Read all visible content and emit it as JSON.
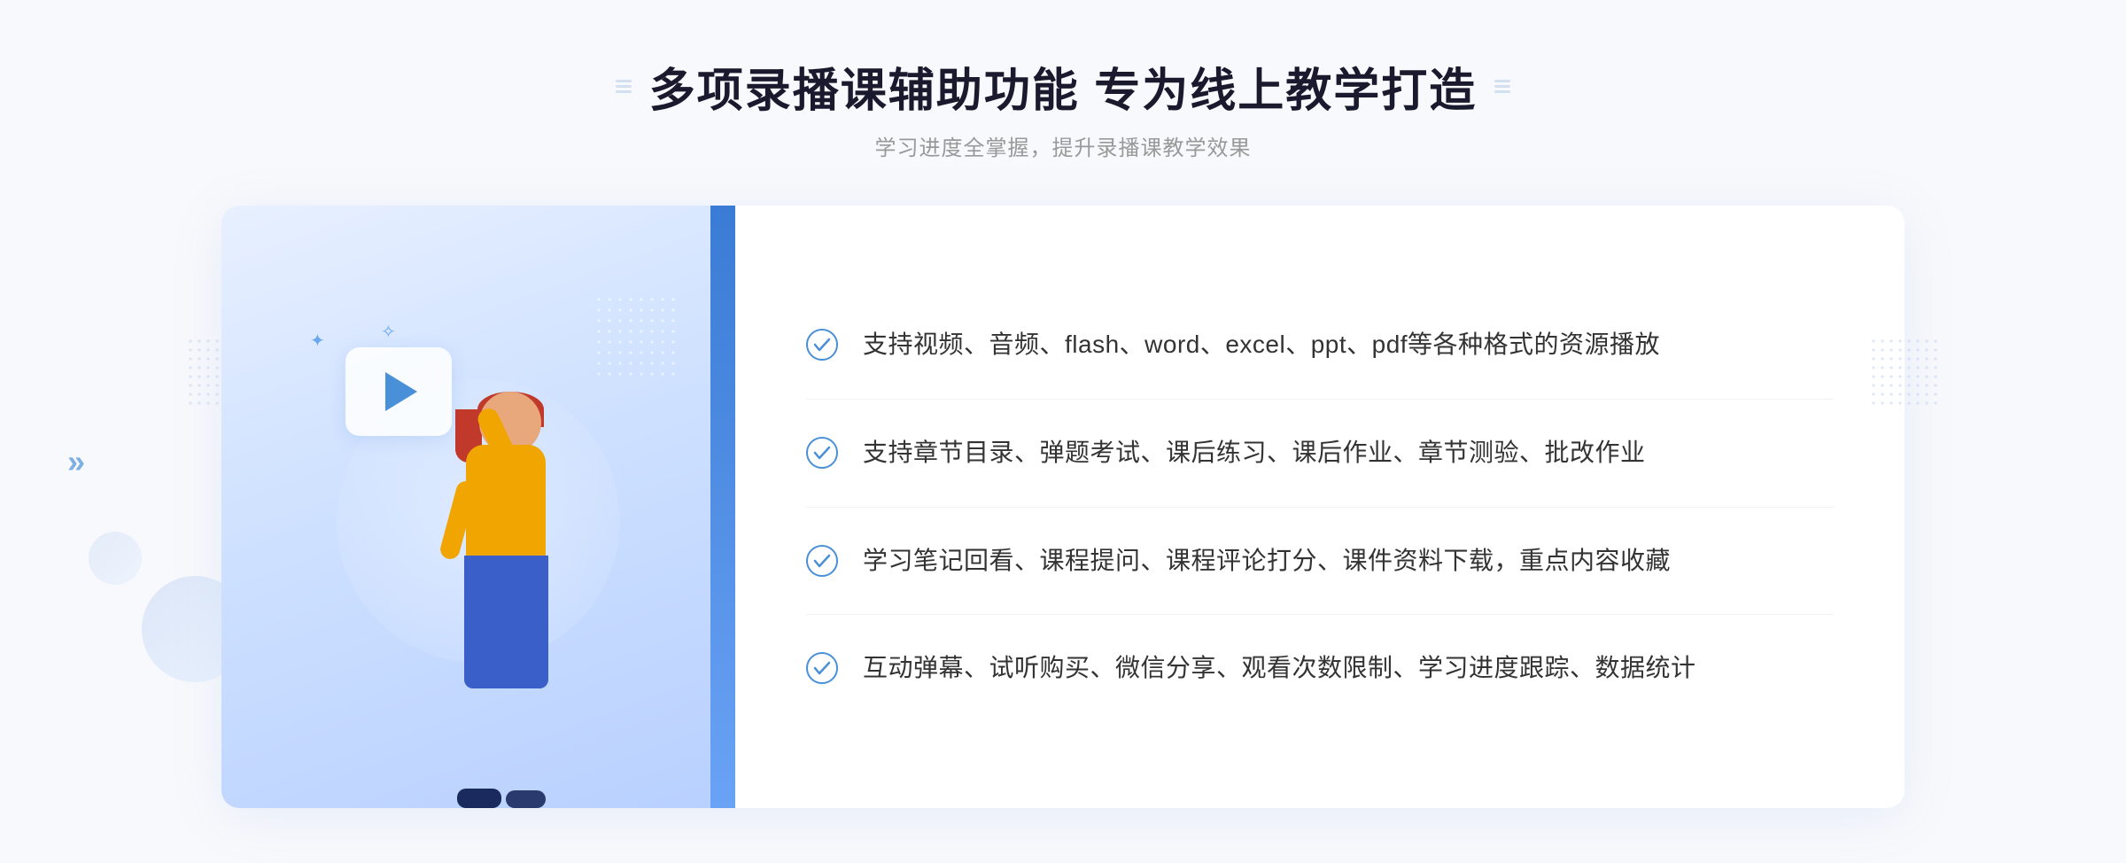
{
  "page": {
    "background": "#f8f9fc"
  },
  "header": {
    "title": "多项录播课辅助功能 专为线上教学打造",
    "subtitle": "学习进度全掌握，提升录播课教学效果",
    "dot_decoration_left": "::::",
    "dot_decoration_right": "::::"
  },
  "features": [
    {
      "id": 1,
      "text": "支持视频、音频、flash、word、excel、ppt、pdf等各种格式的资源播放"
    },
    {
      "id": 2,
      "text": "支持章节目录、弹题考试、课后练习、课后作业、章节测验、批改作业"
    },
    {
      "id": 3,
      "text": "学习笔记回看、课程提问、课程评论打分、课件资料下载，重点内容收藏"
    },
    {
      "id": 4,
      "text": "互动弹幕、试听购买、微信分享、观看次数限制、学习进度跟踪、数据统计"
    }
  ],
  "colors": {
    "primary_blue": "#3a7bd5",
    "light_blue": "#6aa3f5",
    "check_blue": "#4a90d9",
    "text_dark": "#1a1a2e",
    "text_body": "#333333",
    "text_sub": "#999999",
    "bg_card": "#ffffff",
    "bg_panel": "#f8f9fc"
  },
  "decorations": {
    "chevron_left": "»",
    "play_button": "▶"
  }
}
